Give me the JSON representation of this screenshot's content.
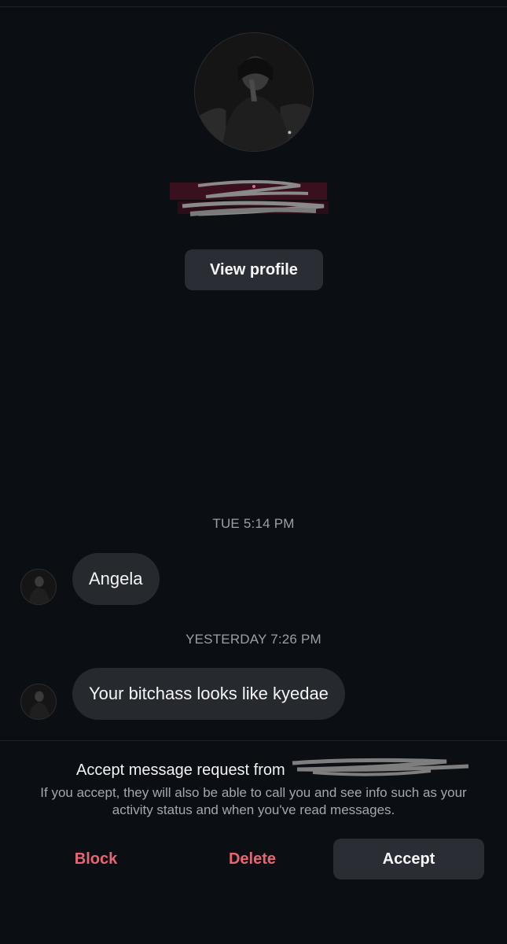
{
  "profile": {
    "avatar_icon": "profile-photo",
    "name_redacted": "",
    "view_profile_label": "View profile"
  },
  "thread": {
    "groups": [
      {
        "timestamp": "TUE 5:14 PM",
        "message": "Angela"
      },
      {
        "timestamp": "YESTERDAY 7:26 PM",
        "message": "Your bitchass looks like kyedae"
      }
    ]
  },
  "request": {
    "title": "Accept message request from",
    "description": "If you accept, they will also be able to call you and see info such as your activity status and when you've read messages.",
    "block_label": "Block",
    "delete_label": "Delete",
    "accept_label": "Accept"
  },
  "colors": {
    "background": "#0b0e12",
    "bubble": "#26292e",
    "button": "#2a2d33",
    "danger": "#e86672",
    "muted_text": "#9ba0a6"
  }
}
